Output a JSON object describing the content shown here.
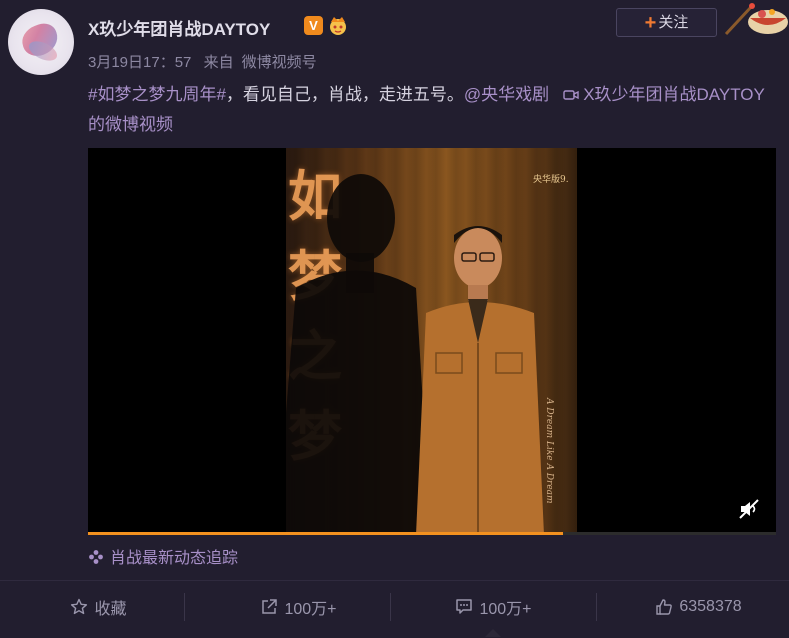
{
  "post": {
    "username": "X玖少年团肖战DAYTOY",
    "vip_badge": "V",
    "follow_label": "关注",
    "follow_plus": "+",
    "meta": {
      "timestamp": "3月19日17：57",
      "source_prefix": "来自",
      "source": "微博视频号"
    },
    "content": {
      "hashtag": "#如梦之梦九周年#",
      "text": "，看见自己，肖战，走进五号。",
      "mention": "@央华戏剧",
      "video_link": "X玖少年团肖战DAYTOY的微博视频"
    },
    "video": {
      "calligraphy": [
        "如",
        "梦",
        "之",
        "梦"
      ],
      "logo_text": "央华版9.",
      "vertical_text": "A Dream Like A Dream",
      "progress_fraction": 0.69,
      "muted": true
    },
    "tracker_label": "肖战最新动态追踪"
  },
  "actions": {
    "favorite_label": "收藏",
    "repost_count": "100万+",
    "comment_count": "100万+",
    "like_count": "6358378"
  },
  "colors": {
    "accent": "#f3911f",
    "link": "#a890c8",
    "background": "#221e2f"
  }
}
